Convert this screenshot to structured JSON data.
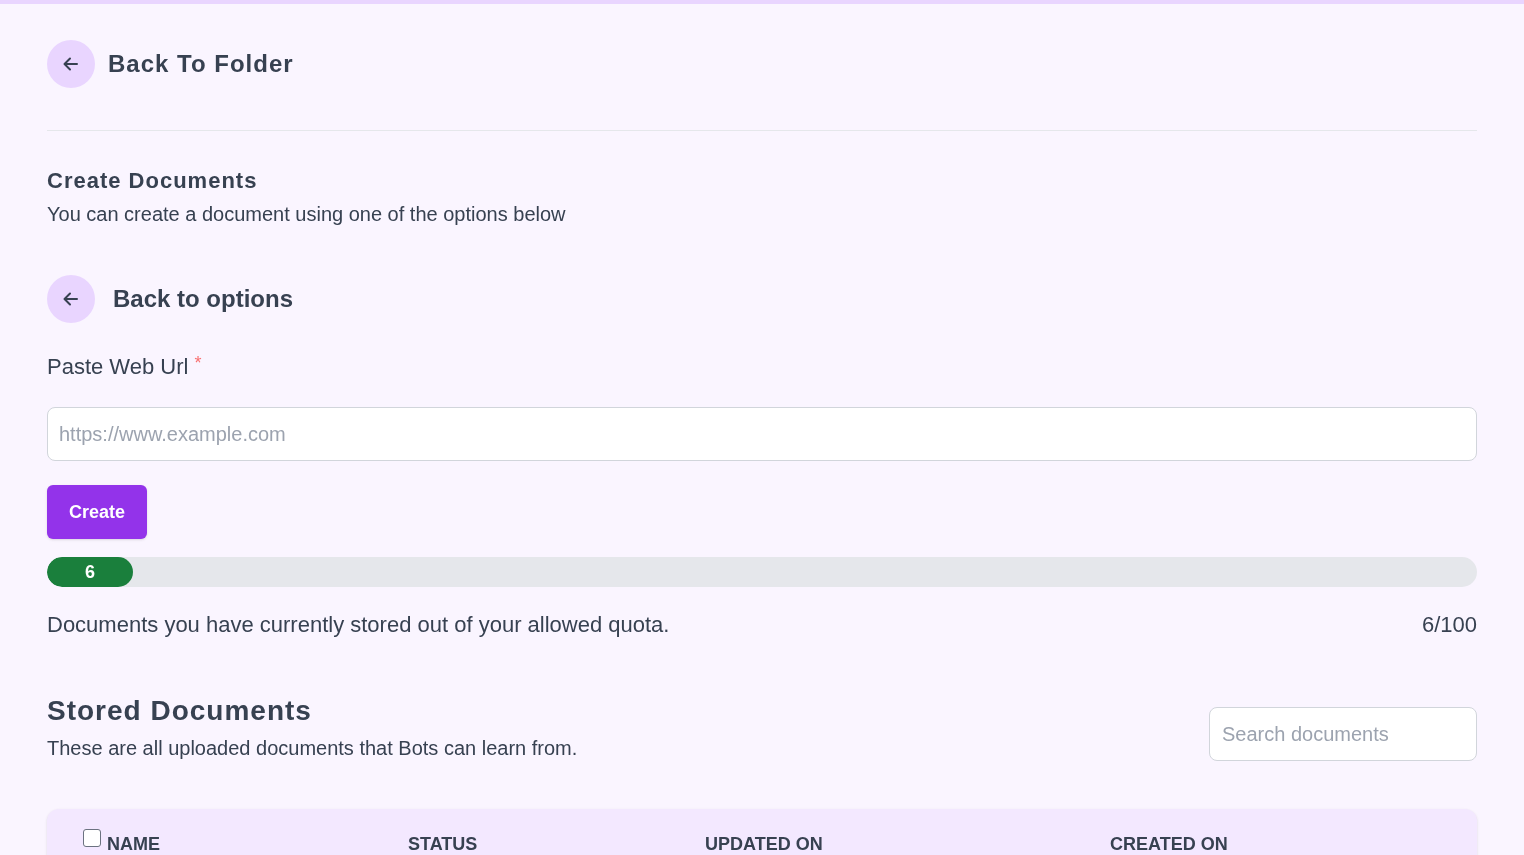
{
  "header": {
    "back_link": "Back To Folder"
  },
  "create_section": {
    "title": "Create Documents",
    "subtitle": "You can create a document using one of the options below",
    "back_link": "Back to options",
    "url_field": {
      "label": "Paste Web Url",
      "required_mark": "*",
      "placeholder": "https://www.example.com"
    },
    "create_button": "Create"
  },
  "quota": {
    "level": 0.06,
    "badge": "6",
    "description": "Documents you have currently stored out of your allowed quota.",
    "count": "6/100"
  },
  "stored_section": {
    "title": "Stored Documents",
    "subtitle": "These are all uploaded documents that Bots can learn from.",
    "search": {
      "placeholder": "Search documents"
    }
  },
  "table": {
    "select_all": {
      "checked": false
    },
    "columns": [
      "NAME",
      "STATUS",
      "UPDATED ON",
      "CREATED ON"
    ]
  }
}
